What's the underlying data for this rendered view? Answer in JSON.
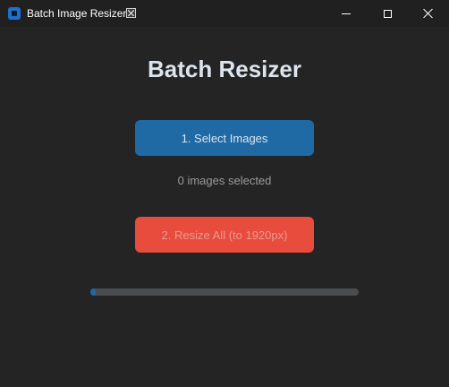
{
  "window": {
    "title": "Batch Image Resizer",
    "controls": {
      "minimize_icon": "minimize-icon",
      "maximize_icon": "maximize-icon",
      "close_icon": "close-icon"
    }
  },
  "main": {
    "heading": "Batch Resizer",
    "select_button_label": "1. Select Images",
    "selection_status": "0 images selected",
    "resize_button_label": "2. Resize All (to 1920px)",
    "progress": 0.02
  },
  "colors": {
    "background": "#242424",
    "titlebar": "#202020",
    "primary_button": "#1f6aa5",
    "danger_button": "#e74c3c",
    "progress_track": "#4a4d50",
    "progress_fill": "#1f6aa5"
  }
}
